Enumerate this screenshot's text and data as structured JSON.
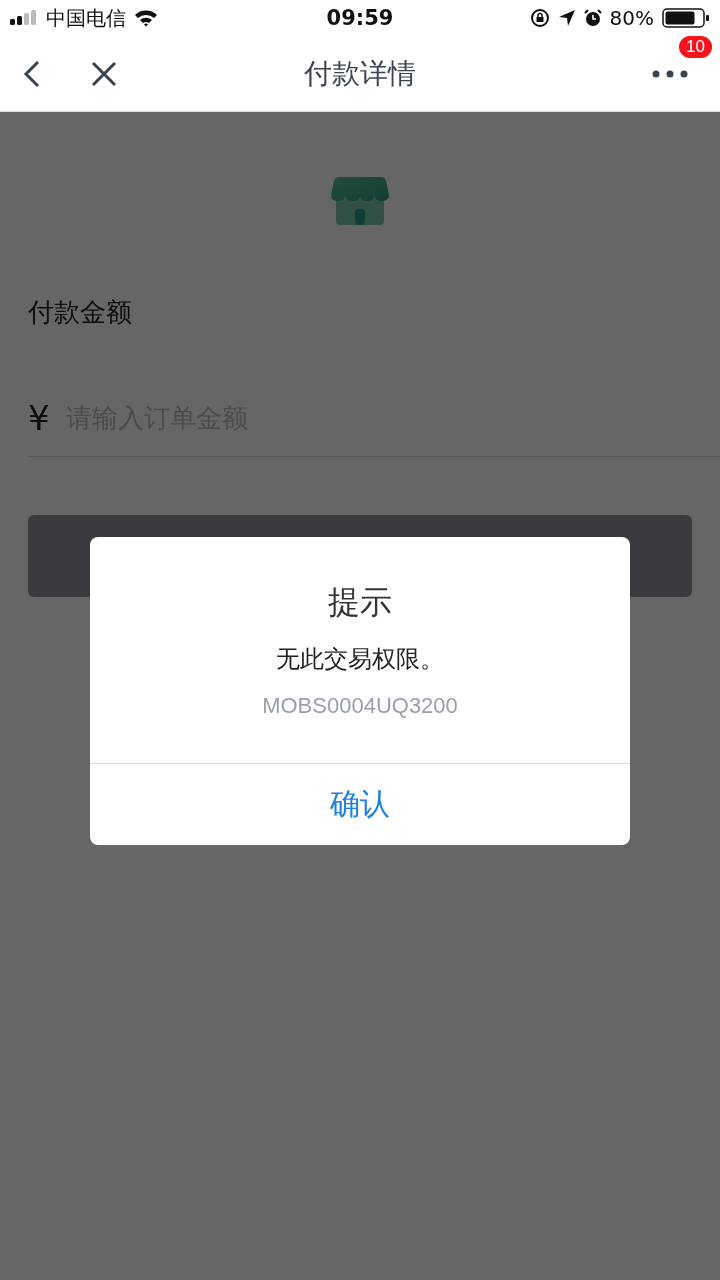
{
  "status_bar": {
    "carrier": "中国电信",
    "time": "09:59",
    "battery": "80%"
  },
  "nav_bar": {
    "title": "付款详情",
    "badge": "10"
  },
  "form": {
    "label": "付款金额",
    "currency": "¥",
    "placeholder": "请输入订单金额"
  },
  "dialog": {
    "title": "提示",
    "message": "无此交易权限。",
    "code": "MOBS0004UQ3200",
    "confirm": "确认"
  }
}
